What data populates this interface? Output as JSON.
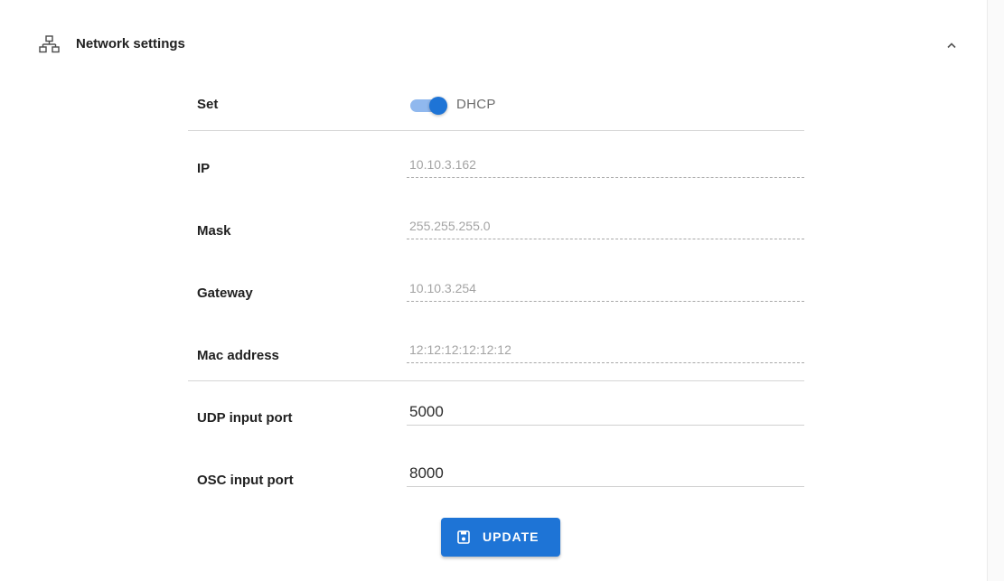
{
  "section": {
    "title": "Network settings",
    "icon": "network-icon",
    "collapse_icon": "chevron-up-icon"
  },
  "rows": {
    "set": {
      "label": "Set",
      "toggle_label": "DHCP",
      "toggle_on": true
    },
    "ip": {
      "label": "IP",
      "value": "10.10.3.162"
    },
    "mask": {
      "label": "Mask",
      "value": "255.255.255.0"
    },
    "gateway": {
      "label": "Gateway",
      "value": "10.10.3.254"
    },
    "mac": {
      "label": "Mac address",
      "value": "12:12:12:12:12:12"
    },
    "udp": {
      "label": "UDP input port",
      "value": "5000"
    },
    "osc": {
      "label": "OSC input port",
      "value": "8000"
    }
  },
  "actions": {
    "update_label": "UPDATE",
    "update_icon": "save-icon"
  },
  "colors": {
    "accent": "#1e74d6",
    "toggle_track": "#90b8ee",
    "disabled_text": "#a4a4a4"
  }
}
